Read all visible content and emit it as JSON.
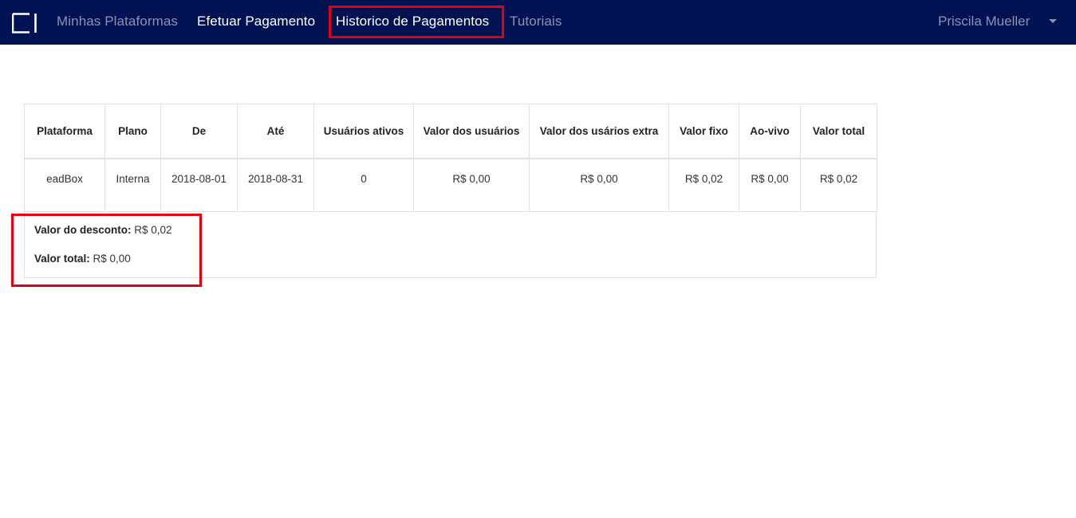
{
  "nav": {
    "items": [
      {
        "label": "Minhas Plataformas"
      },
      {
        "label": "Efetuar Pagamento"
      },
      {
        "label": "Historico de Pagamentos"
      },
      {
        "label": "Tutoriais"
      }
    ],
    "user_name": "Priscila Mueller"
  },
  "table": {
    "headers": [
      "Plataforma",
      "Plano",
      "De",
      "Até",
      "Usuários ativos",
      "Valor dos usuários",
      "Valor dos usários extra",
      "Valor fixo",
      "Ao-vivo",
      "Valor total"
    ],
    "rows": [
      [
        "eadBox",
        "Interna",
        "2018-08-01",
        "2018-08-31",
        "0",
        "R$ 0,00",
        "R$ 0,00",
        "R$ 0,02",
        "R$ 0,00",
        "R$ 0,02"
      ]
    ]
  },
  "summary": {
    "discount_label": "Valor do desconto:",
    "discount_value": "R$ 0,02",
    "total_label": "Valor total:",
    "total_value": "R$ 0,00"
  },
  "colors": {
    "navbar": "#011252",
    "highlight": "#e0000f"
  }
}
